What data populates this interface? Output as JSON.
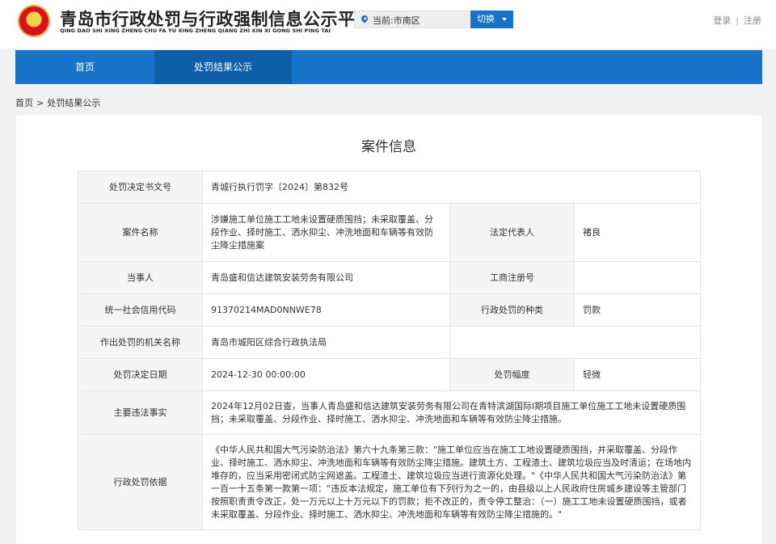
{
  "header": {
    "title": "青岛市行政处罚与行政强制信息公示平台",
    "subtitle": "QING DAO SHI XING ZHENG CHU FA YU XING ZHENG QIANG ZHI XIN XI GONG SHI PING TAI",
    "location_prefix": "当前:",
    "location_value": "市南区",
    "switch_label": "切换",
    "login": "登录",
    "separator": "|",
    "register": "注册"
  },
  "nav": {
    "home": "首页",
    "results": "处罚结果公示"
  },
  "breadcrumb": {
    "home": "首页",
    "arrow": ">",
    "current": "处罚结果公示"
  },
  "panel": {
    "title": "案件信息",
    "labels": {
      "doc_no": "处罚决定书文号",
      "case_name": "案件名称",
      "legal_rep": "法定代表人",
      "party": "当事人",
      "biz_reg_no": "工商注册号",
      "credit_code": "统一社会信用代码",
      "penalty_type": "行政处罚的种类",
      "authority": "作出处罚的机关名称",
      "decision_date": "处罚决定日期",
      "penalty_range": "处罚幅度",
      "facts": "主要违法事实",
      "basis": "行政处罚依据"
    },
    "values": {
      "doc_no": "青城行执行罚字〔2024〕第832号",
      "case_name": "涉嫌施工单位施工工地未设置硬质围挡；未采取覆盖、分段作业、择时施工、洒水抑尘、冲洗地面和车辆等有效防尘降尘措施案",
      "legal_rep": "褚良",
      "party": "青岛盛和信达建筑安装劳务有限公司",
      "biz_reg_no": "",
      "credit_code": "91370214MAD0NNWE78",
      "penalty_type": "罚款",
      "authority": "青岛市城阳区综合行政执法局",
      "decision_date": "2024-12-30 00:00:00",
      "penalty_range": "轻微",
      "facts": "2024年12月02日查，当事人青岛盛和信达建筑安装劳务有限公司在青特滨湖国际I期项目施工单位施工工地未设置硬质围挡；未采取覆盖、分段作业、择时施工、洒水抑尘、冲洗地面和车辆等有效防尘降尘措施。",
      "basis": "《中华人民共和国大气污染防治法》第六十九条第三款：\"施工单位应当在施工工地设置硬质围挡，并采取覆盖、分段作业、择时施工、洒水抑尘、冲洗地面和车辆等有效防尘降尘措施。建筑土方、工程渣土、建筑垃圾应当及时清运；在场地内堆存的，应当采用密闭式防尘网遮盖。工程渣土、建筑垃圾应当进行资源化处理。\"《中华人民共和国大气污染防治法》第一百一十五条第一款第一项：\"违反本法规定，施工单位有下列行为之一的，由县级以上人民政府住房城乡建设等主管部门按照职责责令改正，处一万元以上十万元以下的罚款；拒不改正的，责令停工整治：（一）施工工地未设置硬质围挡，或者未采取覆盖、分段作业、择时施工、洒水抑尘、冲洗地面和车辆等有效防尘降尘措施的。\""
    }
  },
  "colors": {
    "primary_blue": "#1673c8",
    "active_blue": "#0f5ea8",
    "label_bg": "#f5f5f5"
  },
  "icons": {
    "emblem": "national-emblem-icon",
    "location": "location-pin-icon",
    "dropdown": "caret-down-icon"
  }
}
